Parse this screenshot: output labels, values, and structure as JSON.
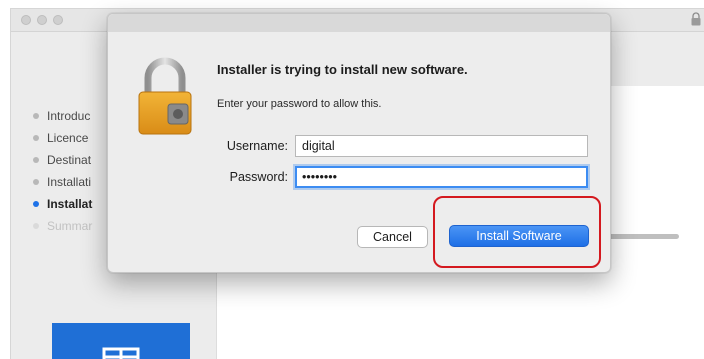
{
  "sidebar": {
    "steps": [
      {
        "label": "Introduc",
        "state": "done"
      },
      {
        "label": "Licence",
        "state": "done"
      },
      {
        "label": "Destinat",
        "state": "done"
      },
      {
        "label": "Installati",
        "state": "done"
      },
      {
        "label": "Installat",
        "state": "active"
      },
      {
        "label": "Summar",
        "state": "pending"
      }
    ]
  },
  "dialog": {
    "title": "Installer is trying to install new software.",
    "message": "Enter your password to allow this.",
    "username_label": "Username:",
    "username_value": "digital",
    "password_label": "Password:",
    "password_value": "••••••••",
    "cancel_label": "Cancel",
    "install_label": "Install Software"
  },
  "colors": {
    "accent": "#1e72e8",
    "highlight": "#d4191f",
    "lock": "#e8a02a"
  },
  "icons": {
    "dialog_icon": "padlock-icon",
    "titlebar_icon": "lock-icon"
  }
}
